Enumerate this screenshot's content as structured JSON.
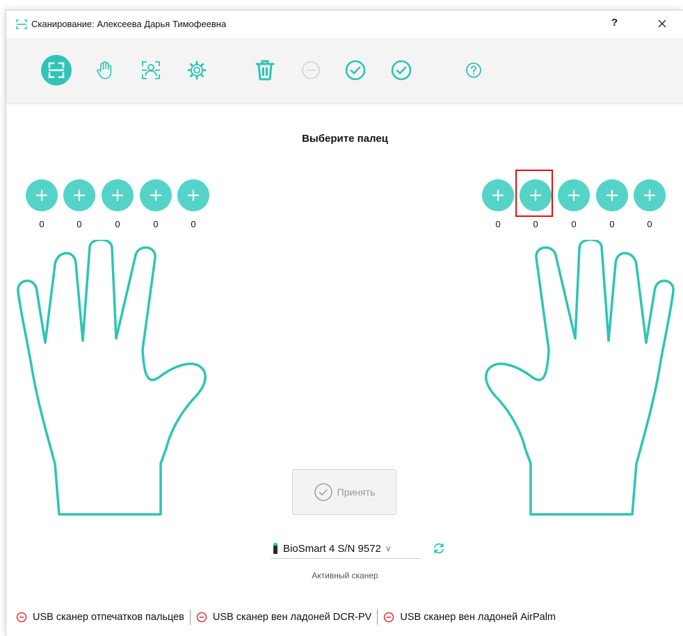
{
  "window": {
    "title": "Сканирование: Алексеева Дарья Тимофеевна",
    "help_label": "?",
    "accent_color": "#2ec4b6"
  },
  "toolbar": {
    "buttons": [
      {
        "name": "scan-fingerprint-button",
        "icon": "scan-frame-icon",
        "active": true
      },
      {
        "name": "palm-button",
        "icon": "hand-icon"
      },
      {
        "name": "face-scan-button",
        "icon": "face-scan-icon"
      },
      {
        "name": "settings-button",
        "icon": "gear-icon"
      },
      {
        "name": "delete-button",
        "icon": "trash-icon"
      },
      {
        "name": "remove-button",
        "icon": "minus-circle-icon",
        "disabled": true
      },
      {
        "name": "confirm-button",
        "icon": "check-circle-icon"
      },
      {
        "name": "confirm-all-button",
        "icon": "check-circle-icon"
      },
      {
        "name": "help-button",
        "icon": "help-icon"
      }
    ]
  },
  "main": {
    "heading": "Выберите палец",
    "left_hand": {
      "counts": [
        "0",
        "0",
        "0",
        "0",
        "0"
      ]
    },
    "right_hand": {
      "counts": [
        "0",
        "0",
        "0",
        "0",
        "0"
      ],
      "highlighted_index": 1
    },
    "accept_label": "Принять",
    "scanner": {
      "selected": "BioSmart 4 S/N 9572",
      "caption": "Активный сканер"
    }
  },
  "status": [
    {
      "label": "USB сканер отпечатков пальцев",
      "state_color": "#e53935"
    },
    {
      "label": "USB сканер вен ладоней DCR-PV",
      "state_color": "#e53935"
    },
    {
      "label": "USB сканер вен ладоней AirPalm",
      "state_color": "#e53935"
    }
  ]
}
